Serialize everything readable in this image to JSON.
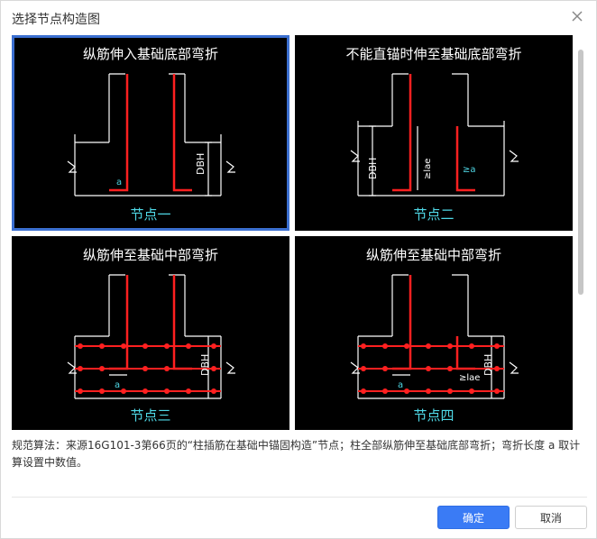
{
  "dialog": {
    "title": "选择节点构造图",
    "close_icon": "close-icon"
  },
  "nodes": [
    {
      "title": "纵筋伸入基础底部弯折",
      "label": "节点一",
      "selected": true,
      "dims": {
        "a": "a",
        "dbh": "DBH"
      }
    },
    {
      "title": "不能直锚时伸至基础底部弯折",
      "label": "节点二",
      "selected": false,
      "dims": {
        "dbh": "DBH",
        "lae_vertical": "≥lae",
        "a": "≥a"
      }
    },
    {
      "title": "纵筋伸至基础中部弯折",
      "label": "节点三",
      "selected": false,
      "dims": {
        "a": "a",
        "dbh": "DBH"
      }
    },
    {
      "title": "纵筋伸至基础中部弯折",
      "label": "节点四",
      "selected": false,
      "dims": {
        "a": "a",
        "lae": "≥lae",
        "dbh": "DBH"
      }
    }
  ],
  "description": "规范算法：来源16G101-3第66页的“柱插筋在基础中锚固构造”节点；柱全部纵筋伸至基础底部弯折；弯折长度 a 取计算设置中数值。",
  "buttons": {
    "ok": "确定",
    "cancel": "取消"
  },
  "colors": {
    "primary": "#3a7bf5",
    "selected_border": "#3b6fd0",
    "label_cyan": "#4fd8e6",
    "rebar_red": "#ff2020"
  }
}
